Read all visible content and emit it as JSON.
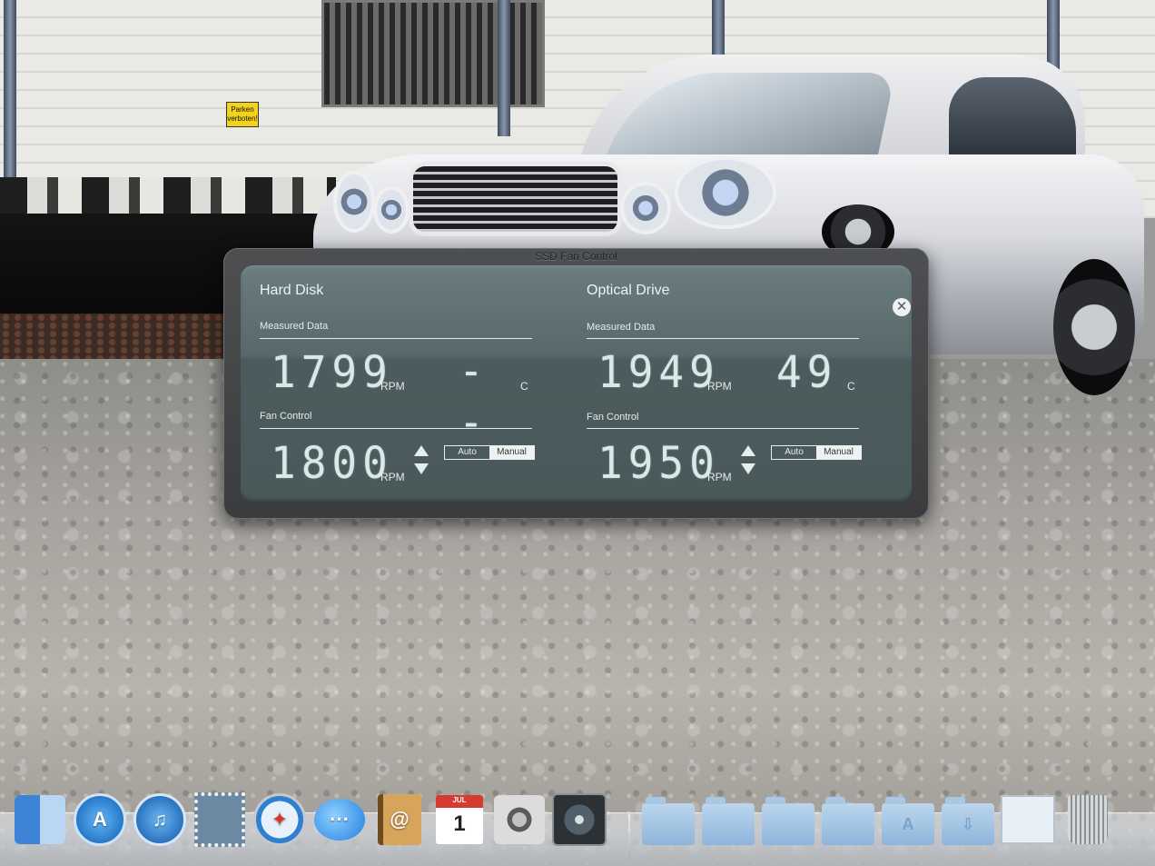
{
  "widget": {
    "title": "SSD Fan Control",
    "close_glyph": "✕",
    "hard_disk": {
      "title": "Hard Disk",
      "measured_label": "Measured Data",
      "rpm_value": "1799",
      "rpm_unit": "RPM",
      "temp_value": "--",
      "temp_unit": "C",
      "fan_control_label": "Fan Control",
      "target_rpm": "1800",
      "target_unit": "RPM",
      "mode_auto": "Auto",
      "mode_manual": "Manual",
      "selected_mode": "Manual"
    },
    "optical_drive": {
      "title": "Optical Drive",
      "measured_label": "Measured Data",
      "rpm_value": "1949",
      "rpm_unit": "RPM",
      "temp_value": "49",
      "temp_unit": "C",
      "fan_control_label": "Fan Control",
      "target_rpm": "1950",
      "target_unit": "RPM",
      "mode_auto": "Auto",
      "mode_manual": "Manual",
      "selected_mode": "Manual"
    }
  },
  "wallpaper": {
    "sign_text": "Parken verboten!"
  },
  "dock": {
    "items": [
      {
        "name": "Finder",
        "icon": "finder-icon"
      },
      {
        "name": "App Store",
        "icon": "app-store-icon",
        "glyph": "A"
      },
      {
        "name": "iTunes",
        "icon": "itunes-icon",
        "glyph": "♫"
      },
      {
        "name": "Mail",
        "icon": "mail-stamp-icon"
      },
      {
        "name": "Safari",
        "icon": "safari-compass-icon",
        "glyph": "✦"
      },
      {
        "name": "iChat",
        "icon": "ichat-bubble-icon",
        "glyph": "···"
      },
      {
        "name": "Address Book",
        "icon": "address-book-icon",
        "glyph": "@"
      },
      {
        "name": "iCal",
        "icon": "calendar-icon",
        "month": "JUL",
        "day": "1"
      },
      {
        "name": "System Preferences",
        "icon": "gear-icon"
      },
      {
        "name": "SSD Fan Control",
        "icon": "fan-icon"
      },
      {
        "name": "Folder",
        "icon": "folder-icon"
      },
      {
        "name": "Folder",
        "icon": "folder-icon"
      },
      {
        "name": "Folder",
        "icon": "folder-icon"
      },
      {
        "name": "Folder",
        "icon": "folder-icon"
      },
      {
        "name": "Applications",
        "icon": "applications-folder-icon",
        "glyph": "A"
      },
      {
        "name": "Downloads",
        "icon": "downloads-folder-icon",
        "glyph": "⇩"
      },
      {
        "name": "Screenshot",
        "icon": "screenshot-stack-icon"
      },
      {
        "name": "Trash",
        "icon": "trash-icon"
      }
    ]
  },
  "colors": {
    "widget_face": "#586a6c",
    "lcd_text": "#dbe8e8",
    "widget_frame": "#454749"
  }
}
